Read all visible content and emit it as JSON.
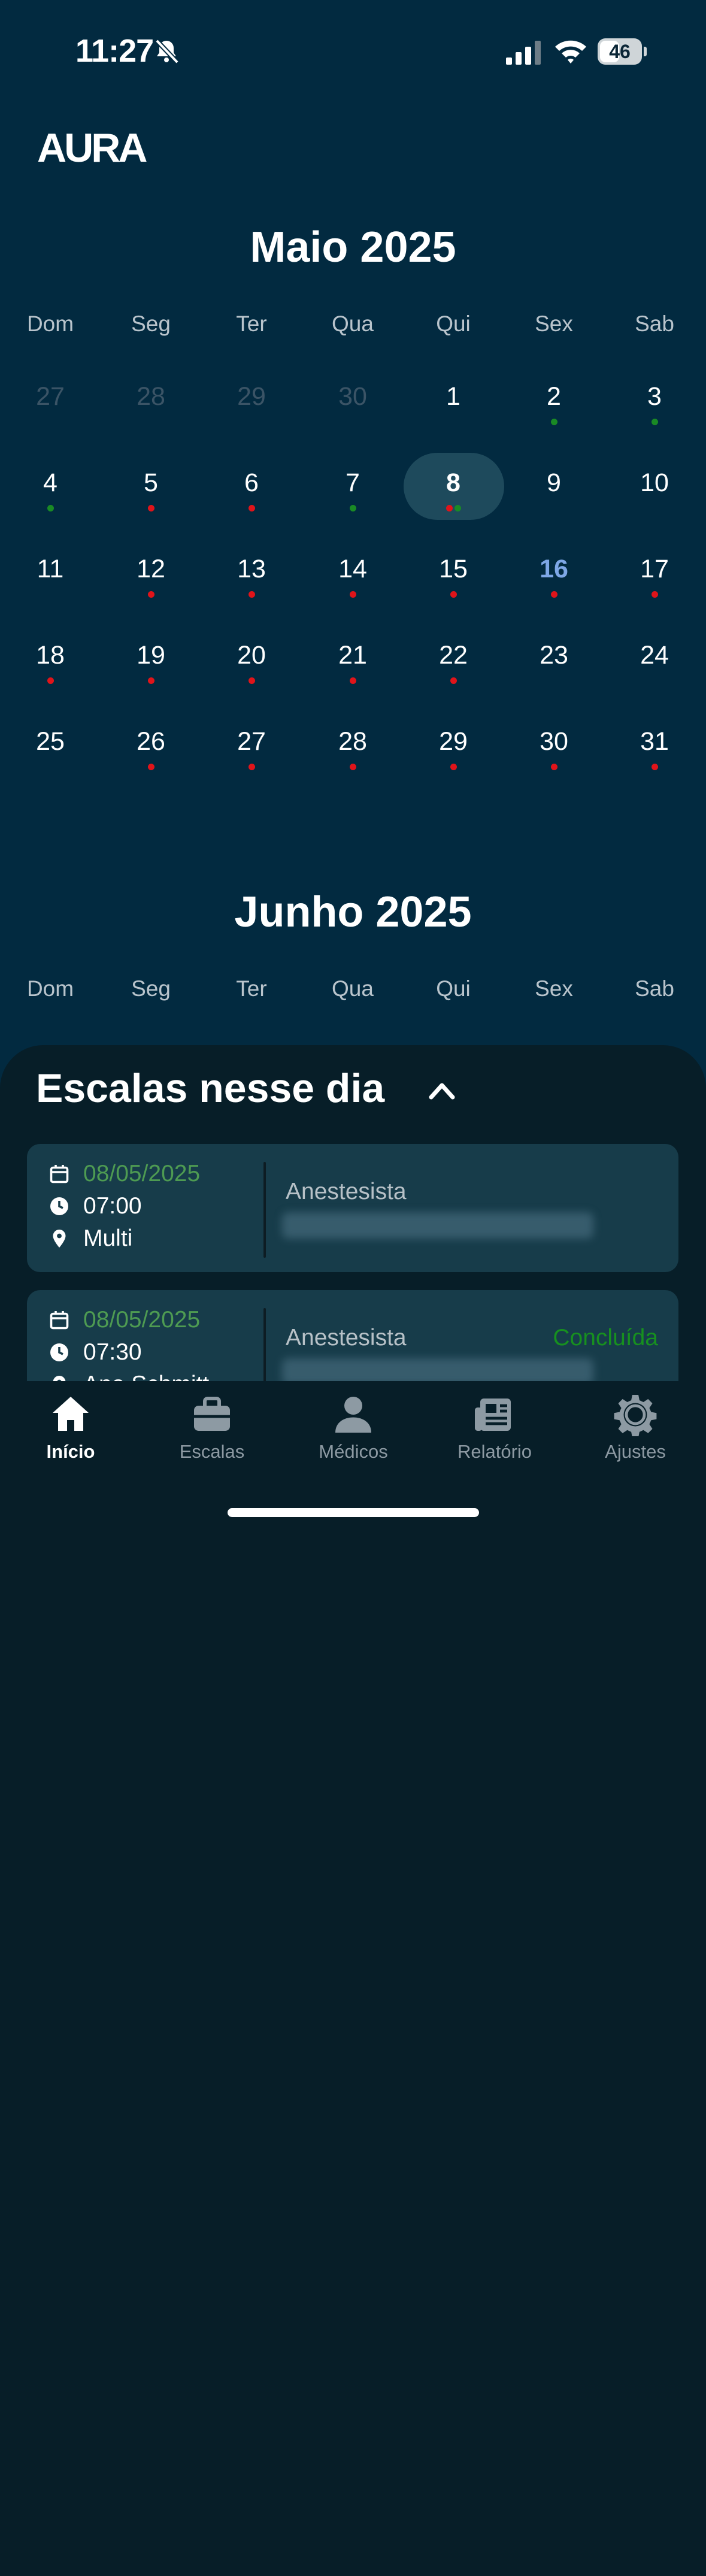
{
  "status_bar": {
    "time": "11:27",
    "battery": "46"
  },
  "app": {
    "logo": "AURA"
  },
  "weekdays": [
    "Dom",
    "Seg",
    "Ter",
    "Qua",
    "Qui",
    "Sex",
    "Sab"
  ],
  "may": {
    "title": "Maio 2025",
    "days": [
      {
        "n": "27",
        "muted": true,
        "dots": []
      },
      {
        "n": "28",
        "muted": true,
        "dots": []
      },
      {
        "n": "29",
        "muted": true,
        "dots": []
      },
      {
        "n": "30",
        "muted": true,
        "dots": []
      },
      {
        "n": "1",
        "dots": []
      },
      {
        "n": "2",
        "dots": [
          "green"
        ]
      },
      {
        "n": "3",
        "dots": [
          "green"
        ]
      },
      {
        "n": "4",
        "dots": [
          "green"
        ]
      },
      {
        "n": "5",
        "dots": [
          "red"
        ]
      },
      {
        "n": "6",
        "dots": [
          "red"
        ]
      },
      {
        "n": "7",
        "dots": [
          "green"
        ]
      },
      {
        "n": "8",
        "selected": true,
        "dots": [
          "red",
          "green"
        ]
      },
      {
        "n": "9",
        "dots": []
      },
      {
        "n": "10",
        "dots": []
      },
      {
        "n": "11",
        "dots": []
      },
      {
        "n": "12",
        "dots": [
          "red"
        ]
      },
      {
        "n": "13",
        "dots": [
          "red"
        ]
      },
      {
        "n": "14",
        "dots": [
          "red"
        ]
      },
      {
        "n": "15",
        "dots": [
          "red"
        ]
      },
      {
        "n": "16",
        "today": true,
        "dots": [
          "red"
        ]
      },
      {
        "n": "17",
        "dots": [
          "red"
        ]
      },
      {
        "n": "18",
        "dots": [
          "red"
        ]
      },
      {
        "n": "19",
        "dots": [
          "red"
        ]
      },
      {
        "n": "20",
        "dots": [
          "red"
        ]
      },
      {
        "n": "21",
        "dots": [
          "red"
        ]
      },
      {
        "n": "22",
        "dots": [
          "red"
        ]
      },
      {
        "n": "23",
        "dots": []
      },
      {
        "n": "24",
        "dots": []
      },
      {
        "n": "25",
        "dots": []
      },
      {
        "n": "26",
        "dots": [
          "red"
        ]
      },
      {
        "n": "27",
        "dots": [
          "red"
        ]
      },
      {
        "n": "28",
        "dots": [
          "red"
        ]
      },
      {
        "n": "29",
        "dots": [
          "red"
        ]
      },
      {
        "n": "30",
        "dots": [
          "red"
        ]
      },
      {
        "n": "31",
        "dots": [
          "red"
        ]
      }
    ]
  },
  "june": {
    "title": "Junho 2025"
  },
  "schedules": {
    "title": "Escalas nesse dia",
    "items": [
      {
        "date": "08/05/2025",
        "time": "07:00",
        "place": "Multi",
        "role": "Anestesista",
        "status": ""
      },
      {
        "date": "08/05/2025",
        "time": "07:30",
        "place": "Ana Schmitt",
        "role": "Anestesista",
        "status": "Concluída"
      }
    ]
  },
  "tabs": [
    {
      "label": "Início",
      "icon": "home-icon",
      "active": true
    },
    {
      "label": "Escalas",
      "icon": "briefcase-icon"
    },
    {
      "label": "Médicos",
      "icon": "person-icon"
    },
    {
      "label": "Relatório",
      "icon": "newspaper-icon"
    },
    {
      "label": "Ajustes",
      "icon": "gear-icon"
    }
  ],
  "colors": {
    "background": "#022a40",
    "sheet": "#071e28",
    "card": "#173c4a",
    "dot_red": "#e0141a",
    "dot_green": "#1a8a25",
    "today": "#7ea7e6",
    "date_green": "#4e9b52",
    "status_green": "#17901f"
  }
}
